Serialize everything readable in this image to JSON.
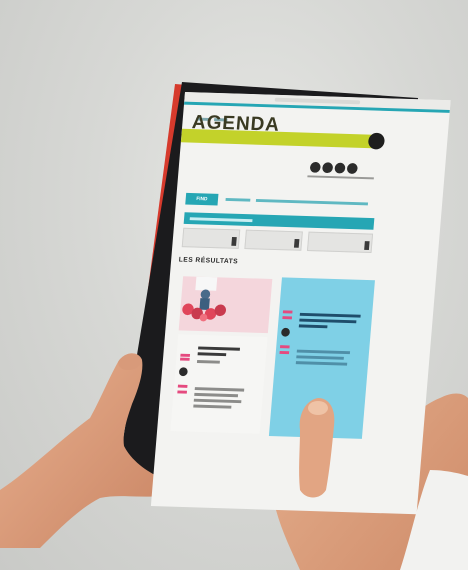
{
  "screen": {
    "site_title": "AGENDA",
    "results_heading": "LES RÉSULTATS",
    "active_tab": "FIND"
  },
  "colors": {
    "accent_teal": "#26a6b4",
    "accent_lime": "#c3d22a",
    "accent_pink": "#e54a7f",
    "card_blue": "#7fd0e6",
    "tablet_case_red": "#d63a2c"
  },
  "icons": {
    "social": [
      "facebook-icon",
      "twitter-icon",
      "instagram-icon",
      "mail-icon"
    ]
  }
}
